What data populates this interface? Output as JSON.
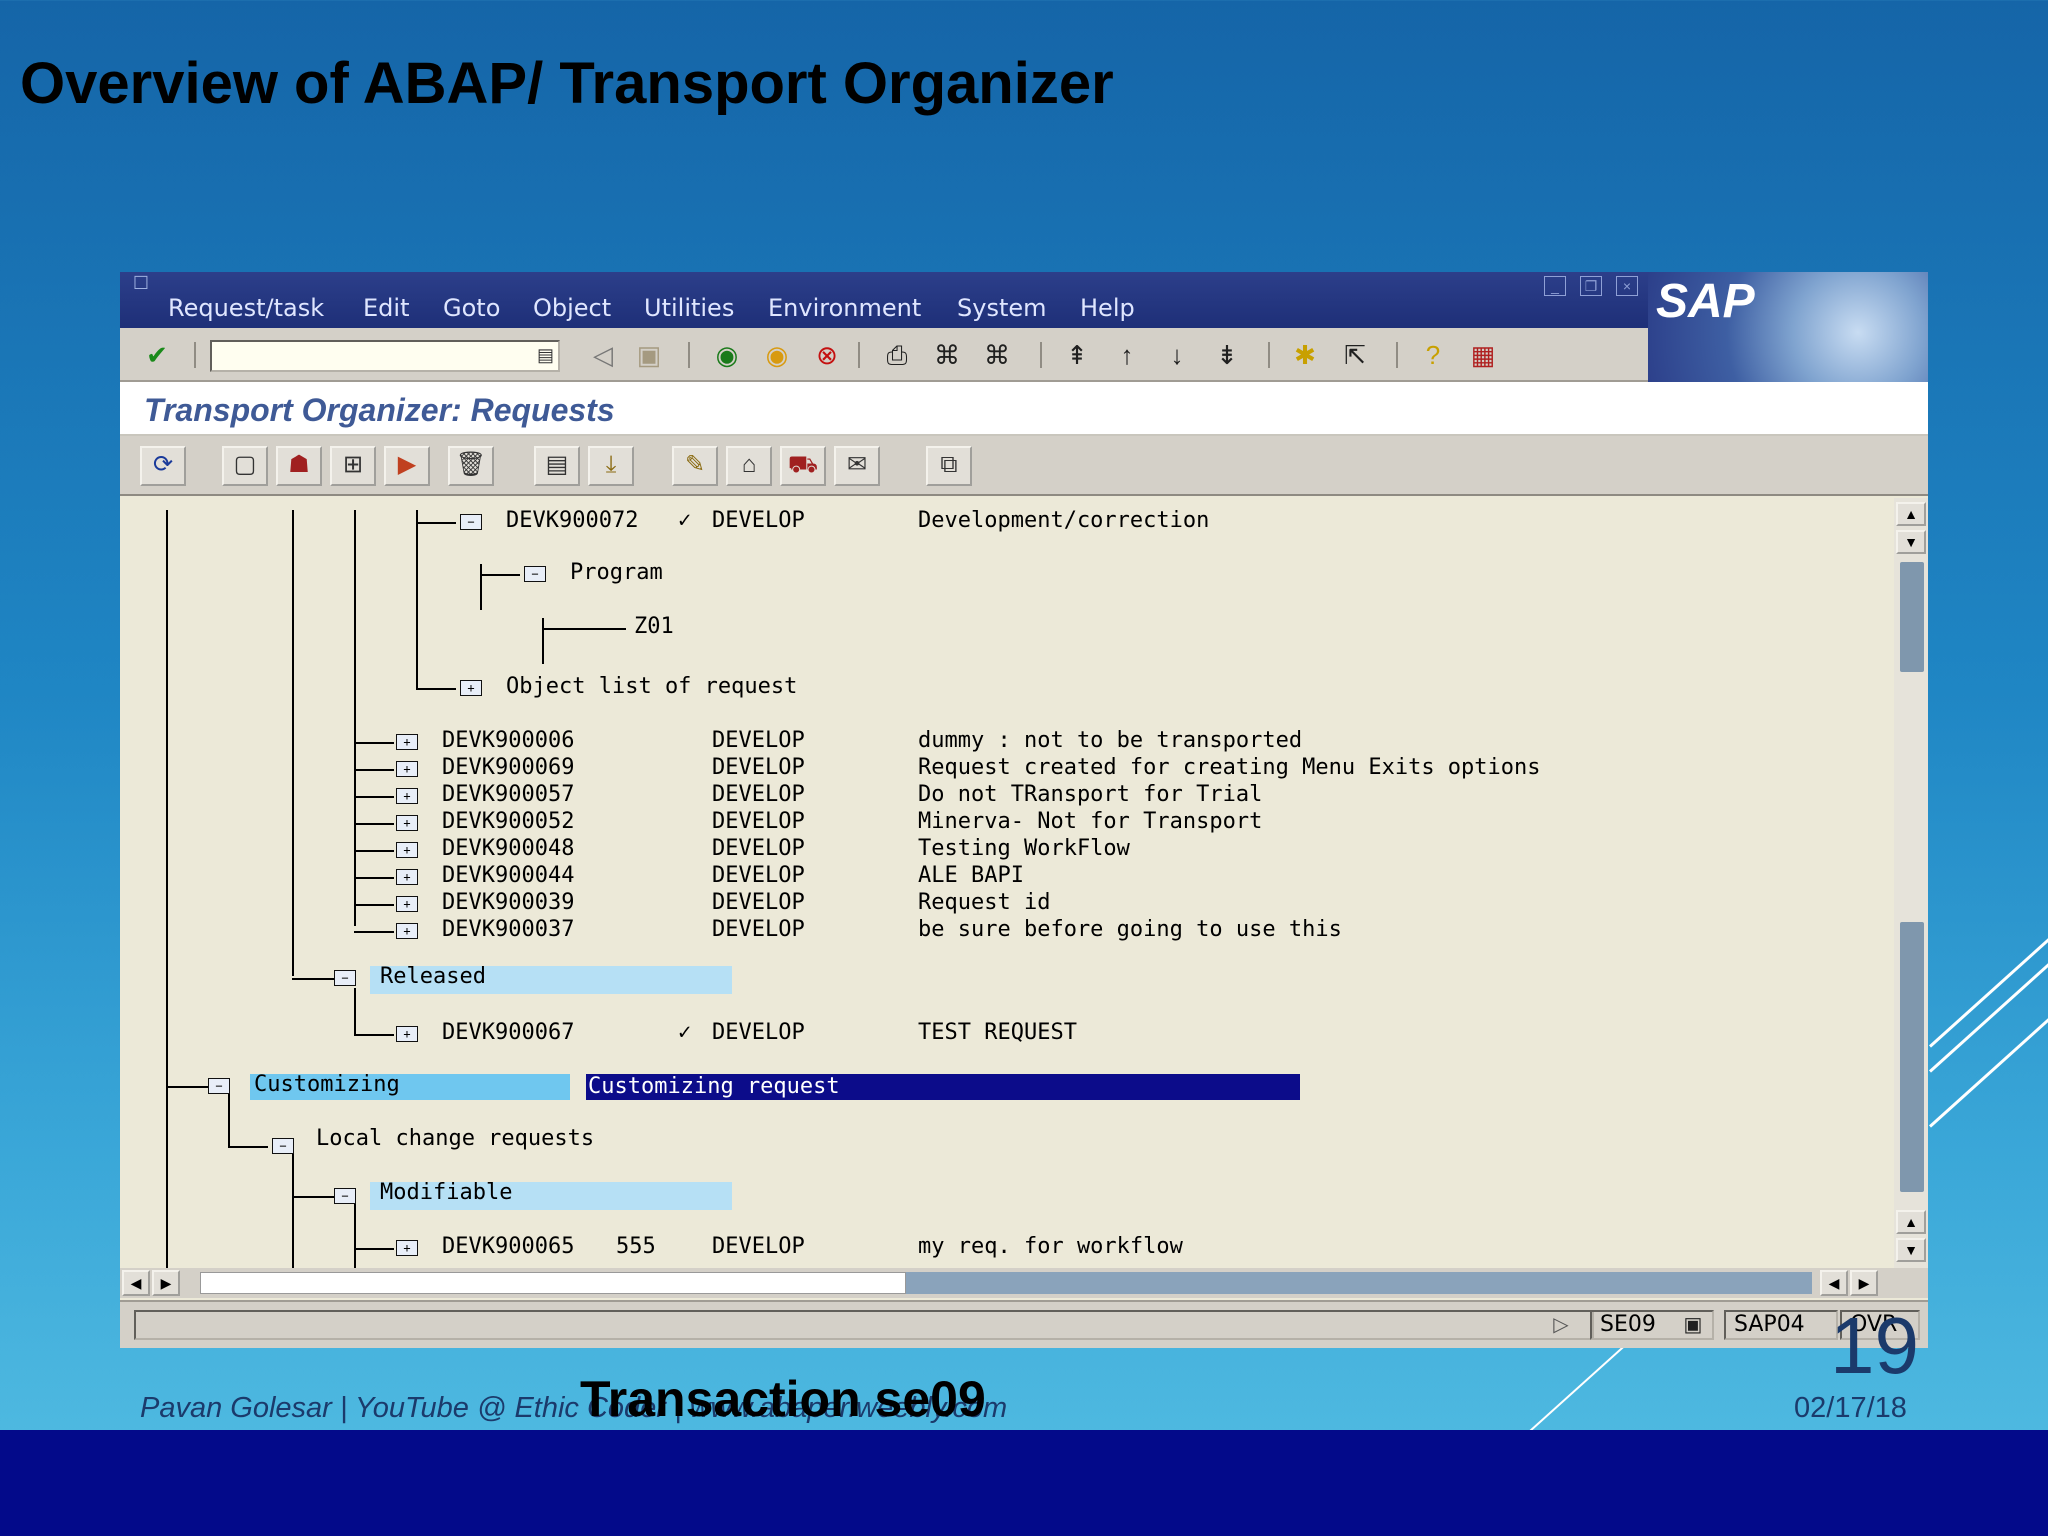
{
  "slide": {
    "title": "Overview of ABAP/ Transport Organizer",
    "caption": "Transaction se09",
    "footer": "Pavan Golesar | YouTube @ Ethic Coder | www.abaper.weebly.com",
    "date": "02/17/18",
    "page_number": "19"
  },
  "sap": {
    "logo": "SAP",
    "menu": [
      "Request/task",
      "Edit",
      "Goto",
      "Object",
      "Utilities",
      "Environment",
      "System",
      "Help"
    ],
    "window_title": "Transport Organizer: Requests",
    "command_field": {
      "value": "",
      "placeholder": ""
    },
    "tree": {
      "devk900072": {
        "id": "DEVK900072",
        "check": "✓",
        "owner": "DEVELOP",
        "desc": "Development/correction"
      },
      "program": "Program",
      "z01": "Z01",
      "object_list": "Object list of request",
      "requests": [
        {
          "id": "DEVK900006",
          "owner": "DEVELOP",
          "desc": "dummy : not to be transported"
        },
        {
          "id": "DEVK900069",
          "owner": "DEVELOP",
          "desc": "Request created for creating Menu Exits options"
        },
        {
          "id": "DEVK900057",
          "owner": "DEVELOP",
          "desc": "Do not TRansport for Trial"
        },
        {
          "id": "DEVK900052",
          "owner": "DEVELOP",
          "desc": "Minerva- Not for Transport"
        },
        {
          "id": "DEVK900048",
          "owner": "DEVELOP",
          "desc": "Testing WorkFlow"
        },
        {
          "id": "DEVK900044",
          "owner": "DEVELOP",
          "desc": "ALE BAPI"
        },
        {
          "id": "DEVK900039",
          "owner": "DEVELOP",
          "desc": "Request id"
        },
        {
          "id": "DEVK900037",
          "owner": "DEVELOP",
          "desc": "be sure before going to use this"
        }
      ],
      "released": "Released",
      "devk900067": {
        "id": "DEVK900067",
        "check": "✓",
        "owner": "DEVELOP",
        "desc": "TEST REQUEST"
      },
      "customizing": "Customizing",
      "customizing_request": "Customizing request",
      "local_change": "Local change requests",
      "modifiable": "Modifiable",
      "devk900065": {
        "id": "DEVK900065",
        "number": "555",
        "owner": "DEVELOP",
        "desc": "my req. for workflow"
      }
    },
    "status": {
      "transaction": "SE09",
      "system": "SAP04",
      "client": "OVR"
    }
  }
}
